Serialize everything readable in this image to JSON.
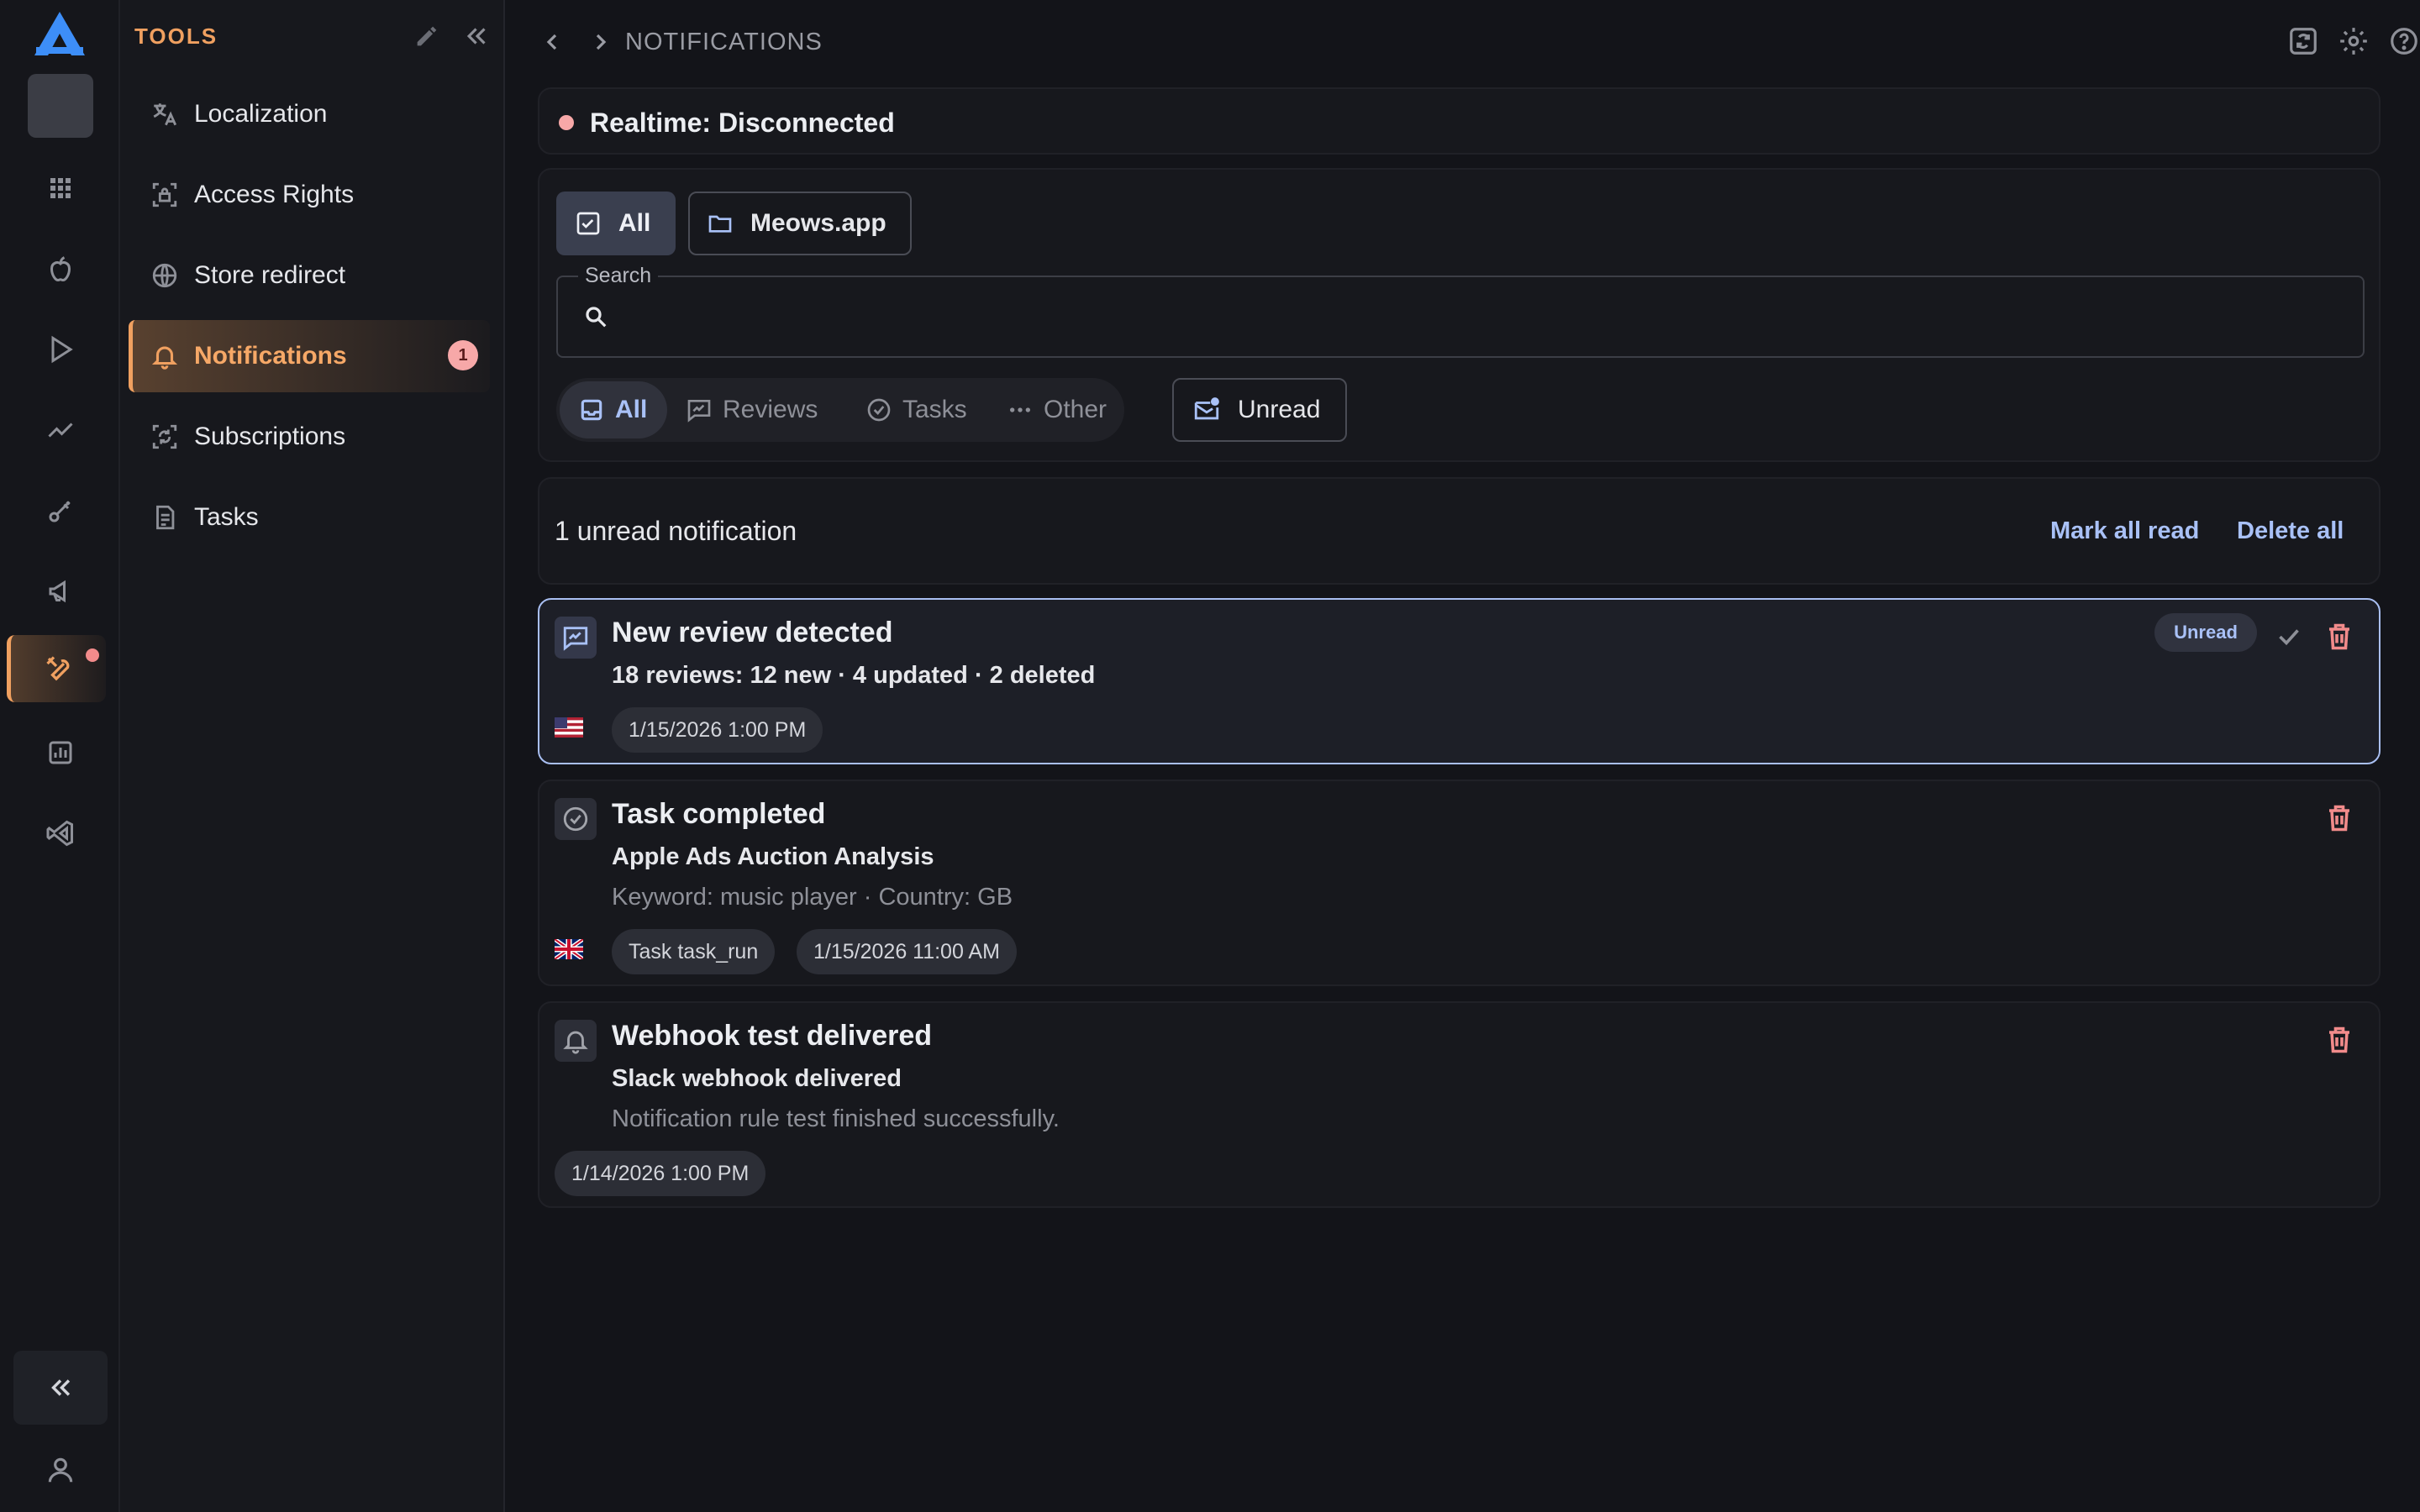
{
  "breadcrumb": {
    "title": "NOTIFICATIONS"
  },
  "sidebar": {
    "heading": "TOOLS",
    "items": [
      {
        "label": "Localization",
        "icon": "translate-icon"
      },
      {
        "label": "Access Rights",
        "icon": "lock-icon"
      },
      {
        "label": "Store redirect",
        "icon": "globe-icon"
      },
      {
        "label": "Notifications",
        "icon": "bell-icon",
        "active": true,
        "badge": "1"
      },
      {
        "label": "Subscriptions",
        "icon": "subscriptions-icon"
      },
      {
        "label": "Tasks",
        "icon": "document-icon"
      }
    ]
  },
  "realtime": {
    "status": "Realtime: Disconnected",
    "status_color": "#f7a8a8"
  },
  "filters": {
    "app_all": "All",
    "app_meows": "Meows.app",
    "search_label": "Search",
    "search_value": "",
    "types": {
      "all": "All",
      "reviews": "Reviews",
      "tasks": "Tasks",
      "other": "Other"
    },
    "unread": "Unread"
  },
  "summary": {
    "count_text": "1 unread notification",
    "mark_all": "Mark all read",
    "delete_all": "Delete all"
  },
  "notifications": [
    {
      "title": "New review detected",
      "subtitle": "18 reviews: 12 new · 4 updated · 2 deleted",
      "flag": "US",
      "pills": [
        "1/15/2026 1:00 PM"
      ],
      "badge": "Unread",
      "unread": true
    },
    {
      "title": "Task completed",
      "subtitle": "Apple Ads Auction Analysis",
      "description": "Keyword: music player · Country: GB",
      "flag": "GB",
      "pills": [
        "Task task_run",
        "1/15/2026 11:00 AM"
      ]
    },
    {
      "title": "Webhook test delivered",
      "subtitle": "Slack webhook delivered",
      "description": "Notification rule test finished successfully.",
      "pills": [
        "1/14/2026 1:00 PM"
      ]
    }
  ],
  "colors": {
    "accent": "#f0a060",
    "link": "#a9c1f7",
    "danger": "#f28b8b"
  }
}
